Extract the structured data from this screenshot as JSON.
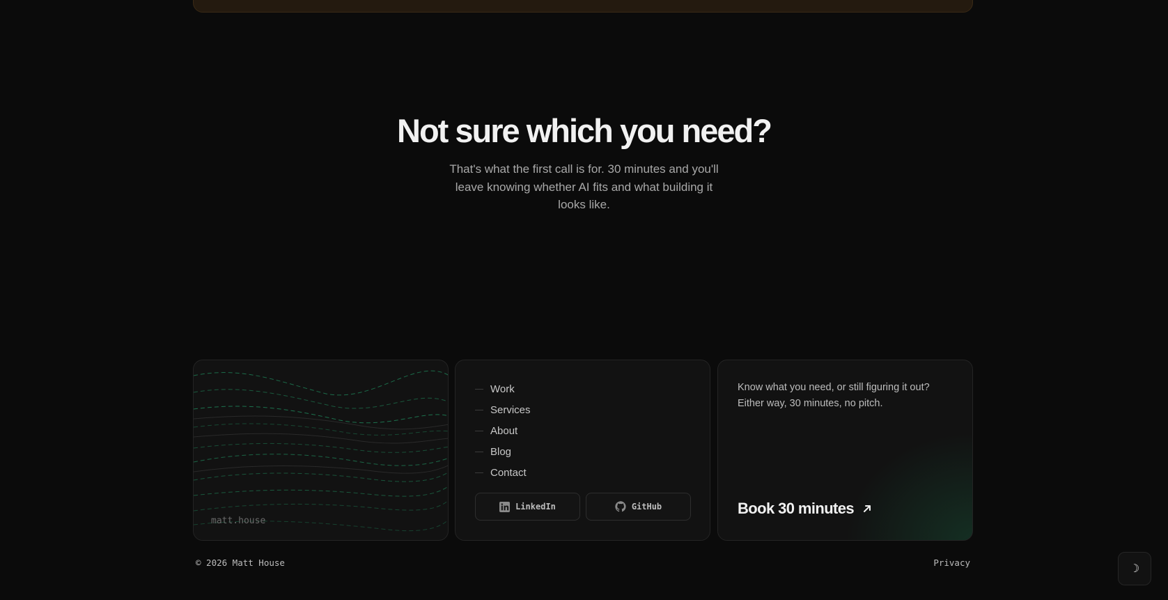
{
  "hero": {
    "title": "Not sure which you need?",
    "subtitle": "That's what the first call is for. 30 minutes and you'll leave knowing whether AI fits and what building it looks like."
  },
  "footer_card_brand": {
    "label": "matt.house"
  },
  "nav": {
    "items": [
      {
        "label": "Work"
      },
      {
        "label": "Services"
      },
      {
        "label": "About"
      },
      {
        "label": "Blog"
      },
      {
        "label": "Contact"
      }
    ]
  },
  "social": {
    "linkedin": {
      "label": "LinkedIn",
      "icon": "linkedin-icon"
    },
    "github": {
      "label": "GitHub",
      "icon": "github-icon"
    }
  },
  "cta": {
    "text": "Know what you need, or still figuring it out? Either way, 30 minutes, no pitch.",
    "link_label": "Book 30 minutes",
    "icon": "arrow-up-right-icon"
  },
  "footer": {
    "copyright": "© 2026 Matt House",
    "privacy": "Privacy"
  },
  "theme_toggle": {
    "glyph": "☽",
    "icon": "moon-icon"
  },
  "colors": {
    "background": "#0b0b0b",
    "card": "#121212",
    "wave_accent": "#1f8a5c",
    "top_card": "#241a0f"
  }
}
